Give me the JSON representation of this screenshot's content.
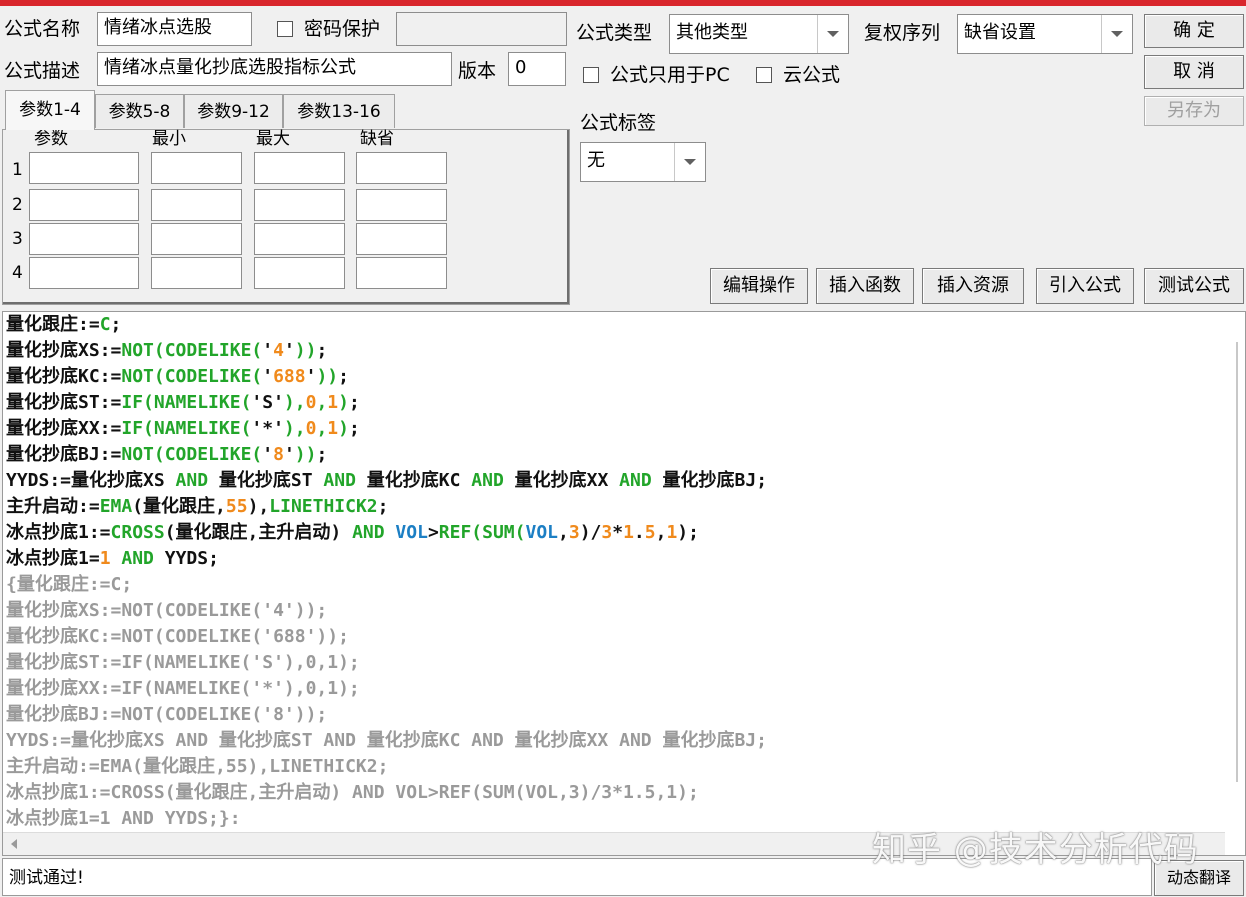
{
  "header": {
    "formula_name_label": "公式名称",
    "formula_name_value": "情绪冰点选股",
    "password_label": "密码保护",
    "formula_desc_label": "公式描述",
    "formula_desc_value": "情绪冰点量化抄底选股指标公式",
    "version_label": "版本",
    "version_value": "0",
    "formula_type_label": "公式类型",
    "formula_type_value": "其他类型",
    "rights_label": "复权序列",
    "rights_value": "缺省设置",
    "pc_only_label": "公式只用于PC",
    "cloud_label": "云公式",
    "tag_label": "公式标签",
    "tag_value": "无"
  },
  "buttons": {
    "ok": "确 定",
    "cancel": "取 消",
    "save_as": "另存为",
    "edit_ops": "编辑操作",
    "insert_func": "插入函数",
    "insert_res": "插入资源",
    "import_formula": "引入公式",
    "test_formula": "测试公式",
    "dynamic_translate": "动态翻译"
  },
  "params": {
    "tabs": [
      "参数1-4",
      "参数5-8",
      "参数9-12",
      "参数13-16"
    ],
    "columns": [
      "参数",
      "最小",
      "最大",
      "缺省"
    ],
    "rows": [
      "1",
      "2",
      "3",
      "4"
    ]
  },
  "code": {
    "lines": [
      [
        [
          "t-plain",
          "量化跟庄:="
        ],
        [
          "t-fn",
          "C"
        ],
        [
          "t-plain",
          ";"
        ]
      ],
      [
        [
          "t-plain",
          "量化抄底XS:="
        ],
        [
          "t-fn",
          "NOT(CODELIKE("
        ],
        [
          "t-plain",
          "'"
        ],
        [
          "t-str",
          "4"
        ],
        [
          "t-plain",
          "'"
        ],
        [
          "t-fn",
          "))"
        ],
        [
          "t-plain",
          ";"
        ]
      ],
      [
        [
          "t-plain",
          "量化抄底KC:="
        ],
        [
          "t-fn",
          "NOT(CODELIKE("
        ],
        [
          "t-plain",
          "'"
        ],
        [
          "t-str",
          "688"
        ],
        [
          "t-plain",
          "'"
        ],
        [
          "t-fn",
          "))"
        ],
        [
          "t-plain",
          ";"
        ]
      ],
      [
        [
          "t-plain",
          "量化抄底ST:="
        ],
        [
          "t-fn",
          "IF(NAMELIKE("
        ],
        [
          "t-plain",
          "'S'"
        ],
        [
          "t-fn",
          "),"
        ],
        [
          "t-num",
          "0"
        ],
        [
          "t-fn",
          ","
        ],
        [
          "t-num",
          "1"
        ],
        [
          "t-fn",
          ")"
        ],
        [
          "t-plain",
          ";"
        ]
      ],
      [
        [
          "t-plain",
          "量化抄底XX:="
        ],
        [
          "t-fn",
          "IF(NAMELIKE("
        ],
        [
          "t-plain",
          "'*'"
        ],
        [
          "t-fn",
          "),"
        ],
        [
          "t-num",
          "0"
        ],
        [
          "t-fn",
          ","
        ],
        [
          "t-num",
          "1"
        ],
        [
          "t-fn",
          ")"
        ],
        [
          "t-plain",
          ";"
        ]
      ],
      [
        [
          "t-plain",
          "量化抄底BJ:="
        ],
        [
          "t-fn",
          "NOT(CODELIKE("
        ],
        [
          "t-plain",
          "'"
        ],
        [
          "t-str",
          "8"
        ],
        [
          "t-plain",
          "'"
        ],
        [
          "t-fn",
          "))"
        ],
        [
          "t-plain",
          ";"
        ]
      ],
      [
        [
          "t-plain",
          "YYDS:=量化抄底XS "
        ],
        [
          "t-fn",
          "AND"
        ],
        [
          "t-plain",
          " 量化抄底ST "
        ],
        [
          "t-fn",
          "AND"
        ],
        [
          "t-plain",
          " 量化抄底KC "
        ],
        [
          "t-fn",
          "AND"
        ],
        [
          "t-plain",
          " 量化抄底XX "
        ],
        [
          "t-fn",
          "AND"
        ],
        [
          "t-plain",
          " 量化抄底BJ;"
        ]
      ],
      [
        [
          "t-plain",
          "主升启动:="
        ],
        [
          "t-fn",
          "EMA"
        ],
        [
          "t-plain",
          "(量化跟庄,"
        ],
        [
          "t-num",
          "55"
        ],
        [
          "t-plain",
          "),"
        ],
        [
          "t-fn",
          "LINETHICK2"
        ],
        [
          "t-plain",
          ";"
        ]
      ],
      [
        [
          "t-plain",
          "冰点抄底1:="
        ],
        [
          "t-fn",
          "CROSS"
        ],
        [
          "t-plain",
          "(量化跟庄,主升启动) "
        ],
        [
          "t-fn",
          "AND"
        ],
        [
          "t-plain",
          " "
        ],
        [
          "t-var",
          "VOL"
        ],
        [
          "t-plain",
          ">"
        ],
        [
          "t-fn",
          "REF(SUM("
        ],
        [
          "t-var",
          "VOL"
        ],
        [
          "t-plain",
          ","
        ],
        [
          "t-num",
          "3"
        ],
        [
          "t-plain",
          ")/"
        ],
        [
          "t-num",
          "3"
        ],
        [
          "t-plain",
          "*"
        ],
        [
          "t-num",
          "1"
        ],
        [
          "t-plain",
          "."
        ],
        [
          "t-num",
          "5"
        ],
        [
          "t-plain",
          ","
        ],
        [
          "t-num",
          "1"
        ],
        [
          "t-plain",
          ");"
        ]
      ],
      [
        [
          "t-plain",
          "冰点抄底1="
        ],
        [
          "t-num",
          "1"
        ],
        [
          "t-plain",
          " "
        ],
        [
          "t-fn",
          "AND"
        ],
        [
          "t-plain",
          " YYDS;"
        ]
      ],
      [
        [
          "t-gray",
          "{量化跟庄:=C;"
        ]
      ],
      [
        [
          "t-gray",
          "量化抄底XS:=NOT(CODELIKE('4'));"
        ]
      ],
      [
        [
          "t-gray",
          "量化抄底KC:=NOT(CODELIKE('688'));"
        ]
      ],
      [
        [
          "t-gray",
          "量化抄底ST:=IF(NAMELIKE('S'),0,1);"
        ]
      ],
      [
        [
          "t-gray",
          "量化抄底XX:=IF(NAMELIKE('*'),0,1);"
        ]
      ],
      [
        [
          "t-gray",
          "量化抄底BJ:=NOT(CODELIKE('8'));"
        ]
      ],
      [
        [
          "t-gray",
          "YYDS:=量化抄底XS AND 量化抄底ST AND 量化抄底KC AND 量化抄底XX AND 量化抄底BJ;"
        ]
      ],
      [
        [
          "t-gray",
          "主升启动:=EMA(量化跟庄,55),LINETHICK2;"
        ]
      ],
      [
        [
          "t-gray",
          "冰点抄底1:=CROSS(量化跟庄,主升启动) AND VOL>REF(SUM(VOL,3)/3*1.5,1);"
        ]
      ],
      [
        [
          "t-gray",
          "冰点抄底1=1 AND YYDS;}:"
        ]
      ]
    ]
  },
  "status": {
    "text": "测试通过!"
  },
  "watermark": "知乎 @技术分析代码"
}
